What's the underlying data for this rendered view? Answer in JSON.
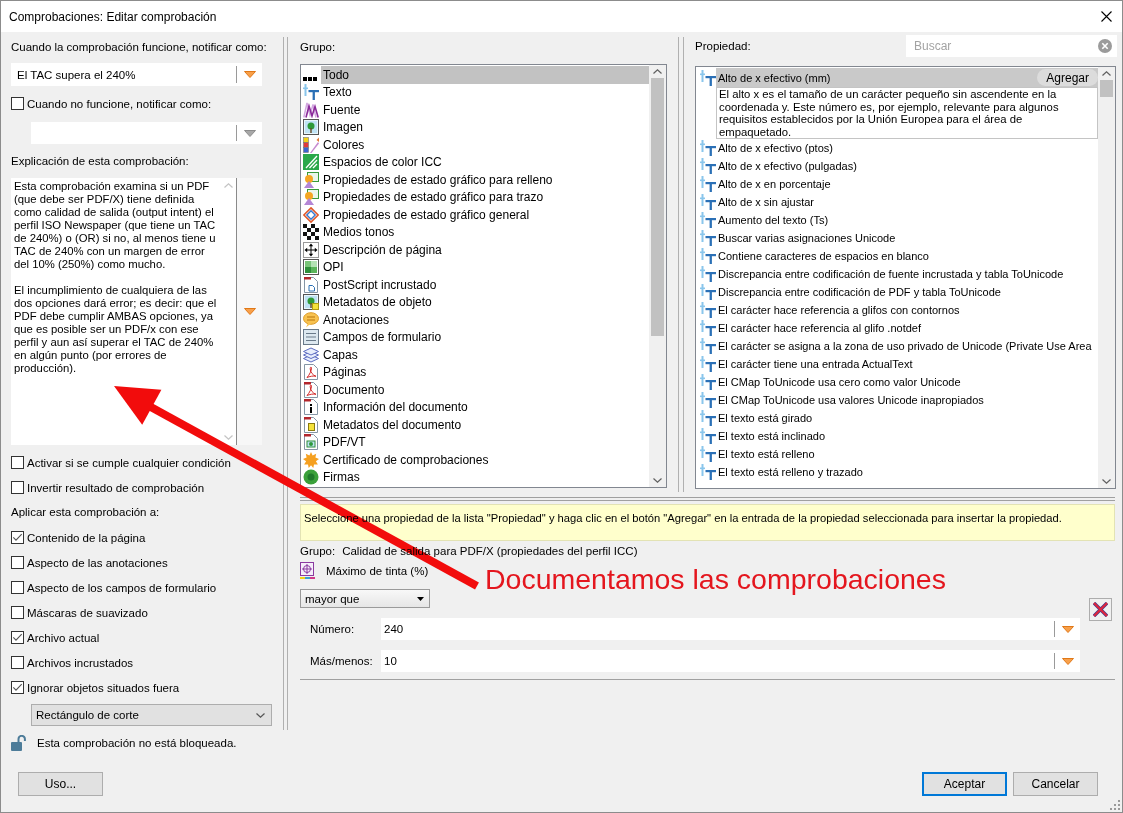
{
  "window": {
    "title": "Comprobaciones: Editar comprobación"
  },
  "notify": {
    "label": "Cuando la comprobación funcione, notificar como:",
    "value": "El TAC supera el 240%"
  },
  "notify_fail": {
    "label": "Cuando no funcione, notificar como:",
    "checked": false
  },
  "explanation": {
    "label": "Explicación de esta comprobación:",
    "paragraphs": [
      "Esta comprobación examina si un PDF (que debe ser PDF/X) tiene definida como calidad de salida (output intent) el perfil ISO Newspaper (que tiene un TAC de 240%) o (OR) si no, al menos tiene u TAC de 240% con un margen de error del 10% (250%) como mucho.",
      "El incumplimiento de cualquiera de las dos opciones dará error; es decir: que el PDF debe cumplir AMBAS opciones, ya que es posible ser un PDF/x con ese perfil y aun así superar el TAC de 240% en algún punto (por errores de producción)."
    ]
  },
  "options": [
    {
      "label": "Activar si se cumple cualquier condición",
      "checked": false
    },
    {
      "label": "Invertir resultado de comprobación",
      "checked": false
    }
  ],
  "apply_to": {
    "label": "Aplicar esta comprobación a:",
    "items": [
      {
        "label": "Contenido de la página",
        "checked": true
      },
      {
        "label": "Aspecto de las anotaciones",
        "checked": false
      },
      {
        "label": "Aspecto de los campos de formulario",
        "checked": false
      },
      {
        "label": "Máscaras de suavizado",
        "checked": false
      },
      {
        "label": "Archivo actual",
        "checked": true
      },
      {
        "label": "Archivos incrustados",
        "checked": false
      },
      {
        "label": "Ignorar objetos situados fuera",
        "checked": true
      }
    ],
    "scope": "Rectángulo de corte"
  },
  "lock": {
    "text": "Esta comprobación no está bloqueada.",
    "locked": false
  },
  "group": {
    "label": "Grupo:",
    "items": [
      {
        "label": "Todo",
        "selected": true
      },
      {
        "label": "Texto",
        "selected": false
      },
      {
        "label": "Fuente",
        "selected": false
      },
      {
        "label": "Imagen",
        "selected": false
      },
      {
        "label": "Colores",
        "selected": false
      },
      {
        "label": "Espacios de color ICC",
        "selected": false
      },
      {
        "label": "Propiedades de estado gráfico para relleno",
        "selected": false
      },
      {
        "label": "Propiedades de estado gráfico para trazo",
        "selected": false
      },
      {
        "label": "Propiedades de estado gráfico general",
        "selected": false
      },
      {
        "label": "Medios tonos",
        "selected": false
      },
      {
        "label": "Descripción de página",
        "selected": false
      },
      {
        "label": "OPI",
        "selected": false
      },
      {
        "label": "PostScript incrustado",
        "selected": false
      },
      {
        "label": "Metadatos de objeto",
        "selected": false
      },
      {
        "label": "Anotaciones",
        "selected": false
      },
      {
        "label": "Campos de formulario",
        "selected": false
      },
      {
        "label": "Capas",
        "selected": false
      },
      {
        "label": "Páginas",
        "selected": false
      },
      {
        "label": "Documento",
        "selected": false
      },
      {
        "label": "Información del documento",
        "selected": false
      },
      {
        "label": "Metadatos del documento",
        "selected": false
      },
      {
        "label": "PDF/VT",
        "selected": false
      },
      {
        "label": "Certificado de comprobaciones",
        "selected": false
      },
      {
        "label": "Firmas",
        "selected": false
      }
    ]
  },
  "property": {
    "label": "Propiedad:",
    "search": {
      "placeholder": "Buscar"
    },
    "items": [
      {
        "label": "Alto de x efectivo (mm)",
        "selected": true,
        "action": "Agregar",
        "description": "El alto x es el tamaño de un carácter pequeño sin ascendente en la coordenada y. Este número es, por ejemplo, relevante para algunos requisitos establecidos por la Unión Europea para el área de empaquetado."
      },
      {
        "label": "Alto de x efectivo (ptos)",
        "selected": false
      },
      {
        "label": "Alto de x efectivo (pulgadas)",
        "selected": false
      },
      {
        "label": "Alto de x en porcentaje",
        "selected": false
      },
      {
        "label": "Alto de x sin ajustar",
        "selected": false
      },
      {
        "label": "Aumento del texto (Ts)",
        "selected": false
      },
      {
        "label": "Buscar varias asignaciones Unicode",
        "selected": false
      },
      {
        "label": "Contiene caracteres de espacios en blanco",
        "selected": false
      },
      {
        "label": "Discrepancia entre codificación de fuente incrustada y tabla ToUnicode",
        "selected": false
      },
      {
        "label": "Discrepancia entre codificación de PDF y tabla ToUnicode",
        "selected": false
      },
      {
        "label": "El carácter hace referencia a glifos con contornos",
        "selected": false
      },
      {
        "label": "El carácter hace referencia al glifo .notdef",
        "selected": false
      },
      {
        "label": "El carácter se asigna a la zona de uso privado de Unicode (Private Use Area",
        "selected": false
      },
      {
        "label": "El carácter tiene una entrada ActualText",
        "selected": false
      },
      {
        "label": "El CMap ToUnicode usa cero como valor Unicode",
        "selected": false
      },
      {
        "label": "El CMap ToUnicode usa valores Unicode inapropiados",
        "selected": false
      },
      {
        "label": "El texto está girado",
        "selected": false
      },
      {
        "label": "El texto está inclinado",
        "selected": false
      },
      {
        "label": "El texto está relleno",
        "selected": false
      },
      {
        "label": "El texto está relleno y trazado",
        "selected": false
      }
    ]
  },
  "hint": "Seleccione una propiedad de la lista \"Propiedad\" y haga clic en el botón \"Agregar\" en la entrada de la propiedad seleccionada para insertar la propiedad.",
  "condition": {
    "group_label": "Grupo:",
    "group_value": "Calidad de salida para PDF/X (propiedades del perfil ICC)",
    "property": "Máximo de tinta (%)",
    "operator": "mayor que",
    "fields": [
      {
        "label": "Número:",
        "value": "240"
      },
      {
        "label": "Más/menos:",
        "value": "10"
      }
    ]
  },
  "buttons": {
    "usage": "Uso...",
    "actions": [
      {
        "label": "Aceptar",
        "default": true
      },
      {
        "label": "Cancelar",
        "default": false
      }
    ]
  },
  "annotation": {
    "text": "Documentamos las comprobaciones"
  }
}
